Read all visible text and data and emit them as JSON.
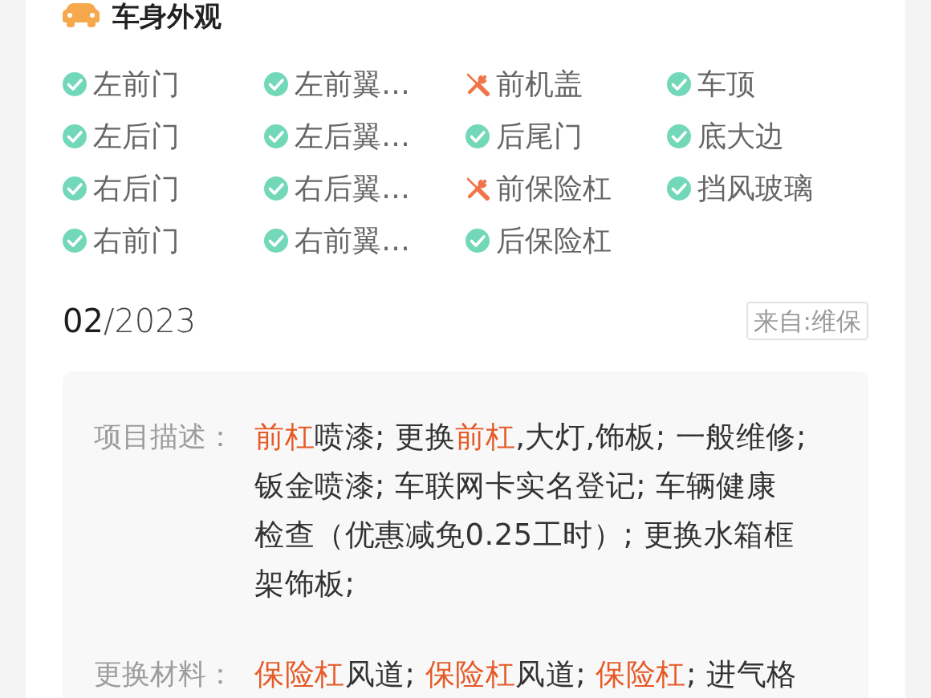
{
  "section": {
    "title": "车身外观"
  },
  "parts": [
    {
      "label": "左前门",
      "kind": "ok"
    },
    {
      "label": "左前翼…",
      "kind": "ok"
    },
    {
      "label": "前机盖",
      "kind": "repaired"
    },
    {
      "label": "车顶",
      "kind": "ok"
    },
    {
      "label": "左后门",
      "kind": "ok"
    },
    {
      "label": "左后翼…",
      "kind": "ok"
    },
    {
      "label": "后尾门",
      "kind": "ok"
    },
    {
      "label": "底大边",
      "kind": "ok"
    },
    {
      "label": "右后门",
      "kind": "ok"
    },
    {
      "label": "右后翼…",
      "kind": "ok"
    },
    {
      "label": "前保险杠",
      "kind": "repaired"
    },
    {
      "label": "挡风玻璃",
      "kind": "ok"
    },
    {
      "label": "右前门",
      "kind": "ok"
    },
    {
      "label": "右前翼…",
      "kind": "ok"
    },
    {
      "label": "后保险杠",
      "kind": "ok"
    }
  ],
  "record": {
    "date": "**02**/2023",
    "source": "来自:维保",
    "details": [
      {
        "label": "项目描述：",
        "lines": [
          "**前杠**喷漆; 更换**前杠**,大灯,饰板; 一般维修;",
          "钣金喷漆; 车联网卡实名登记; 车辆健康",
          "检查（优惠减免0.25工时）; 更换水箱框",
          "架饰板;"
        ]
      },
      {
        "label": "更换材料：",
        "lines": [
          "**保险杠**风道; **保险杠**风道; **保险杠**; 进气格"
        ]
      }
    ]
  }
}
